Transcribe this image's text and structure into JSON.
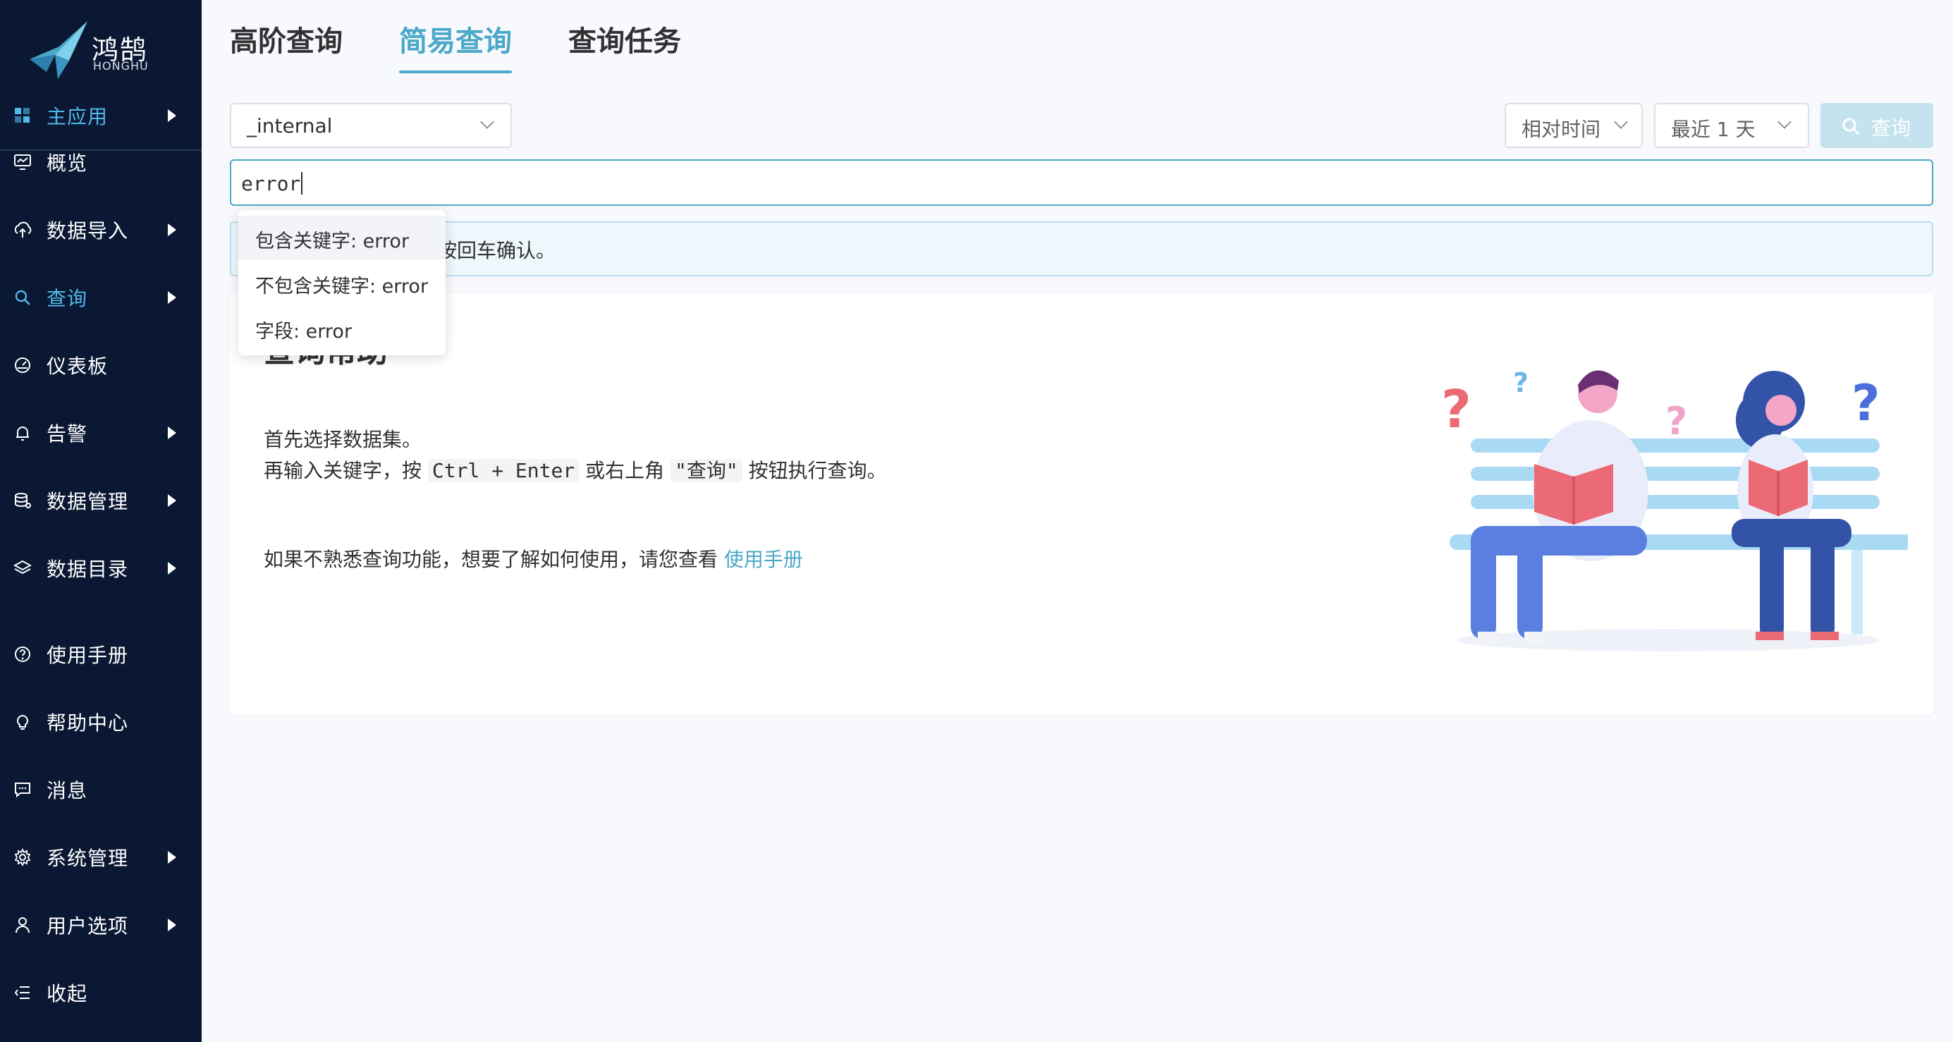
{
  "brand": {
    "name": "鸿鹄",
    "sub": "HONGHU"
  },
  "sidebar": {
    "main_app": "主应用",
    "items": [
      {
        "label": "概览",
        "icon": "monitor-icon",
        "arrow": false
      },
      {
        "label": "数据导入",
        "icon": "cloud-upload-icon",
        "arrow": true
      },
      {
        "label": "查询",
        "icon": "search-icon",
        "arrow": true,
        "active": true
      },
      {
        "label": "仪表板",
        "icon": "dashboard-icon",
        "arrow": false
      },
      {
        "label": "告警",
        "icon": "bell-icon",
        "arrow": true
      },
      {
        "label": "数据管理",
        "icon": "database-icon",
        "arrow": true
      },
      {
        "label": "数据目录",
        "icon": "layers-icon",
        "arrow": true
      },
      {
        "label": "使用手册",
        "icon": "help-circle-icon",
        "arrow": false
      },
      {
        "label": "帮助中心",
        "icon": "lightbulb-icon",
        "arrow": false
      },
      {
        "label": "消息",
        "icon": "message-icon",
        "arrow": false
      },
      {
        "label": "系统管理",
        "icon": "gear-icon",
        "arrow": true
      },
      {
        "label": "用户选项",
        "icon": "user-icon",
        "arrow": true
      },
      {
        "label": "收起",
        "icon": "collapse-icon",
        "arrow": false
      }
    ]
  },
  "tabs": [
    "高阶查询",
    "简易查询",
    "查询任务"
  ],
  "active_tab": "简易查询",
  "toolbar": {
    "dataset": "_internal",
    "time_mode": "相对时间",
    "time_range": "最近 1 天",
    "query_button": "查询"
  },
  "query": {
    "value": "error"
  },
  "info_bar": {
    "text": "按回车确认。"
  },
  "suggestions": [
    "包含关键字: error",
    "不包含关键字: error",
    "字段: error"
  ],
  "help": {
    "title": "查询帮助",
    "line1": "首先选择数据集。",
    "line2_pre": "再输入关键字，按",
    "line2_kbd": "Ctrl + Enter",
    "line2_mid": "或右上角",
    "line2_btn": "\"查询\"",
    "line2_post": "按钮执行查询。",
    "line3": "如果不熟悉查询功能，想要了解如何使用，请您查看",
    "manual_link": "使用手册"
  }
}
